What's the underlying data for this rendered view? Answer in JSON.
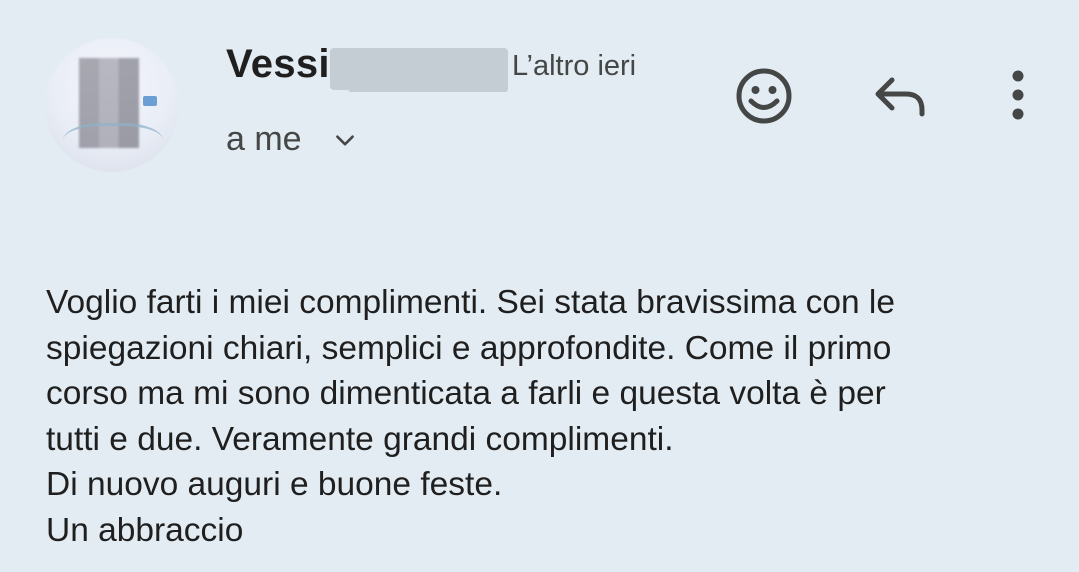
{
  "message": {
    "sender": "Vessi",
    "time": "L’altro ieri",
    "recipient": "a me",
    "body": {
      "lines": [
        "Voglio farti i miei complimenti. Sei stata bravissima con le",
        "spiegazioni chiari, semplici e approfondite. Come il primo",
        "corso ma mi sono dimenticata a farli e questa volta è per",
        "tutti e due. Veramente grandi complimenti.",
        "Di nuovo auguri e buone feste.",
        "Un abbraccio"
      ]
    }
  },
  "actions": {
    "emoji": "emoji-reaction-icon",
    "reply": "reply-icon",
    "more": "more-vert-icon"
  },
  "colors": {
    "background": "#e3ecf3",
    "text": "#1f1f1f",
    "secondary_text": "#444746",
    "redaction": "#c4ccd4"
  }
}
